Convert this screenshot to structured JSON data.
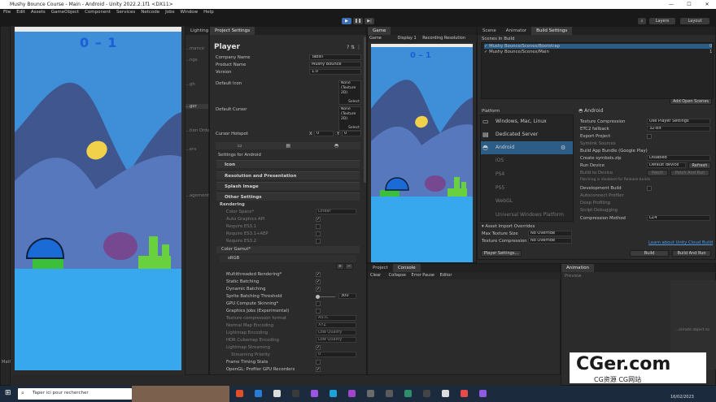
{
  "window": {
    "title": "Mushy Bounce Course - Main - Android - Unity 2022.2.1f1 <DX11>",
    "controls": [
      "—",
      "☐",
      "✕"
    ]
  },
  "menu": [
    "File",
    "Edit",
    "Assets",
    "GameObject",
    "Component",
    "Services",
    "Netcode",
    "Jobs",
    "Window",
    "Help"
  ],
  "toolbar": {
    "play": "▶",
    "pause": "❚❚",
    "step": "▶|",
    "layers": "Layers",
    "layout": "Layout"
  },
  "phone": {
    "score": "0 – 1"
  },
  "lefttabs": {
    "lighting": "Lighting",
    "project_settings": "Project Settings"
  },
  "project_settings_partial": [
    "...mance",
    "...ngs",
    "...gh",
    "...ger",
    "...tion Order",
    "...ers",
    "...agement"
  ],
  "player": {
    "header": "Player",
    "company_label": "Company Name",
    "company_value": "Tabsil",
    "product_label": "Product Name",
    "product_value": "Mushy Bounce",
    "version_label": "Version",
    "version_value": "1.0",
    "default_icon": "Default Icon",
    "default_cursor": "Default Cursor",
    "none_texture": "None\n(Texture 2D)",
    "select": "Select",
    "hotspot_label": "Cursor Hotspot",
    "x_label": "X",
    "x_value": "0",
    "y_label": "Y",
    "y_value": "0",
    "settings_for": "Settings for Android",
    "sections": [
      "Icon",
      "Resolution and Presentation",
      "Splash Image",
      "Other Settings"
    ],
    "rendering": "Rendering",
    "color_space": "Color Space*",
    "color_space_value": "Linear",
    "auto_graphics": "Auto Graphics API",
    "req1": "Require ES3.1",
    "req2": "Require ES3.1+AEP",
    "req3": "Require ES3.2",
    "color_gamut": "Color Gamut*",
    "srgb": "sRGB",
    "options": [
      {
        "label": "Multithreaded Rendering*",
        "on": true
      },
      {
        "label": "Static Batching",
        "on": true
      },
      {
        "label": "Dynamic Batching",
        "on": true
      },
      {
        "label": "Sprite Batching Threshold",
        "on": false
      },
      {
        "label": "GPU Compute Skinning*",
        "on": false
      },
      {
        "label": "Graphics Jobs (Experimental)",
        "on": false
      },
      {
        "label": "Texture compression format",
        "on": false
      },
      {
        "label": "Normal Map Encoding",
        "on": false
      },
      {
        "label": "Lightmap Encoding",
        "on": false
      },
      {
        "label": "HDR Cubemap Encoding",
        "on": false
      },
      {
        "label": "Lightmap Streaming",
        "on": false
      },
      {
        "label": "Streaming Priority",
        "on": false
      },
      {
        "label": "Frame Timing Stats",
        "on": true
      },
      {
        "label": "OpenGL: Profiler GPU Recorders",
        "on": true
      }
    ],
    "threshold_value": "300",
    "tex_format": "ASTC",
    "normal_map": "XYZ",
    "lightmap_enc": "Low Quality",
    "hdr_enc": "Low Quality",
    "stream_priority": "0"
  },
  "game": {
    "tab": "Game",
    "display": "Game",
    "display_sel": "Display 1",
    "resolution": "Recording Resolution",
    "score": "0 – 1"
  },
  "build": {
    "tabs": [
      "Scene",
      "Animator",
      "Build Settings"
    ],
    "scenes_header": "Scenes In Build",
    "scenes": [
      "Mushy Bounce/Scenes/Bootstrap",
      "Mushy Bounce/Scenes/Main"
    ],
    "scene_idx": [
      "0",
      "1"
    ],
    "add_open": "Add Open Scenes",
    "platform": "Platform",
    "platforms": [
      "Windows, Mac, Linux",
      "Dedicated Server",
      "Android",
      "iOS",
      "PS4",
      "PS5",
      "WebGL",
      "Universal Windows Platform"
    ],
    "android_title": "Android",
    "tex_comp": "Texture Compression",
    "tex_comp_val": "Use Player Settings",
    "etc2": "ETC2 fallback",
    "etc2_val": "32-bit",
    "export": "Export Project",
    "symlink": "Symlink Sources",
    "bundle": "Build App Bundle (Google Play)",
    "symbols": "Create symbols.zip",
    "symbols_val": "Disabled",
    "run_device": "Run Device",
    "run_device_val": "Default device",
    "refresh": "Refresh",
    "build_to_device": "Build to Device",
    "patch": "Patch",
    "patch_run": "Patch And Run",
    "patch_note": "Patching is disabled for Release builds.",
    "dev_build": "Development Build",
    "autoconnect": "Autoconnect Profiler",
    "deep": "Deep Profiling",
    "script_debug": "Script Debugging",
    "compression": "Compression Method",
    "compression_val": "LZ4",
    "import_overrides": "Asset Import Overrides",
    "max_tex": "Max Texture Size",
    "max_tex_val": "No Override",
    "tex_comp2": "Texture Compression",
    "tex_comp2_val": "No Override",
    "learn": "Learn about Unity Cloud Build",
    "player_settings_btn": "Player Settings...",
    "build_btn": "Build",
    "build_run_btn": "Build And Run"
  },
  "console": {
    "tabs": [
      "Project",
      "Console"
    ],
    "clear": "Clear",
    "collapse": "Collapse",
    "error_pause": "Error Pause",
    "editor": "Editor"
  },
  "animation": {
    "tab": "Animation",
    "preview": "Preview",
    "msg": "...nimate object so"
  },
  "project_tree": {
    "item": "Mathematics"
  },
  "taskbar": {
    "search": "Taper ici pour rechercher",
    "time": "15:00",
    "date": "16/02/2023"
  },
  "watermark": {
    "main": "CGer.com",
    "sub": "CG资源 CG网站"
  },
  "colors": {
    "sky": "#3f8fd8",
    "hill_dark": "#40568f",
    "hill_light": "#5778bd",
    "ground": "#37a8ee",
    "yellow": "#f2d14a",
    "mushroom": "#1a6bd6",
    "play": "#3c6fb0",
    "selected": "#2c5d87"
  }
}
